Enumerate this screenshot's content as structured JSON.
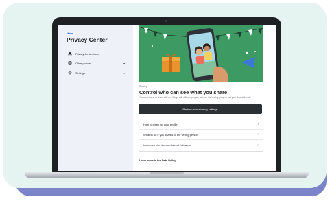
{
  "sidebar": {
    "logo": "Meta",
    "title": "Privacy Center",
    "items": [
      {
        "label": "Privacy Center home",
        "icon": "home-icon",
        "chevron": ""
      },
      {
        "label": "Other policies",
        "icon": "document-icon",
        "chevron": "▾"
      },
      {
        "label": "Settings",
        "icon": "gear-icon",
        "chevron": "▾"
      }
    ]
  },
  "main": {
    "section_tag": "Sharing",
    "title": "Control who can see what you share",
    "description": "You can choose to share different things with different people, whether that's a big group or just your closest friends.",
    "review_button": "Review your sharing settings",
    "links": [
      {
        "label": "How to clean up your profile",
        "chevron": "›"
      },
      {
        "label": "What to do if you shared to the wrong person",
        "chevron": "›"
      },
      {
        "label": "Unknown friend requests and followers",
        "chevron": "›"
      }
    ],
    "learn_more": "Learn more in the Data Policy"
  },
  "colors": {
    "backdrop": "#7b84c9",
    "card": "#e5f3f1",
    "hero_green": "#3d9a63",
    "button_dark": "#2b3034"
  }
}
